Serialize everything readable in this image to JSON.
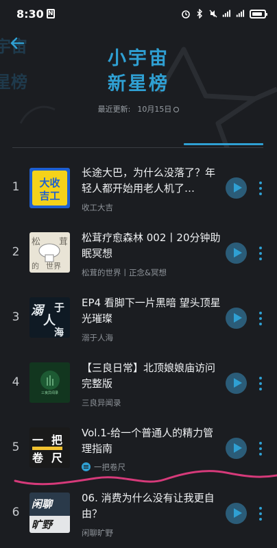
{
  "status_bar": {
    "time": "8:30"
  },
  "header": {
    "title_line1": "小宇宙",
    "title_line2": "新星榜",
    "update_label": "最近更新:",
    "update_date": "10月15日",
    "bg_text_line1": "宇宙",
    "bg_text_line2": "星榜"
  },
  "episodes": [
    {
      "rank": "1",
      "title": "长途大巴，为什么没落了？年轻人都开始用老人机了…",
      "podcast": "收工大吉",
      "cover_text": "大收吉工",
      "cover_bg": "#1e5fd0"
    },
    {
      "rank": "2",
      "title": "松茸疗愈森林 002丨20分钟助眠冥想",
      "podcast": "松茸的世界丨正念&冥想",
      "cover_text": "松茸的世界",
      "cover_bg": "#e9e4d6"
    },
    {
      "rank": "3",
      "title": "EP4 看脚下一片黑暗 望头顶星光璀璨",
      "podcast": "溺于人海",
      "cover_text": "溺于人海",
      "cover_bg": "#0f1a24"
    },
    {
      "rank": "4",
      "title": "【三良日常】北顶娘娘庙访问完整版",
      "podcast": "三良异闻录",
      "cover_text": "三良异闻录",
      "cover_bg": "#12361f"
    },
    {
      "rank": "5",
      "title": "Vol.1-给一个普通人的精力管理指南",
      "podcast": "一把卷尺",
      "cover_text": "一把卷尺",
      "cover_bg": "#1a1a1a"
    },
    {
      "rank": "6",
      "title": "06. 消费为什么没有让我更自由？",
      "podcast": "闲聊旷野",
      "cover_text": "闲聊旷野",
      "cover_bg": "#2a3a4a"
    }
  ],
  "colors": {
    "accent": "#2fa0d3",
    "background": "#1b1d21",
    "highlight_stroke": "#d63a7a"
  }
}
